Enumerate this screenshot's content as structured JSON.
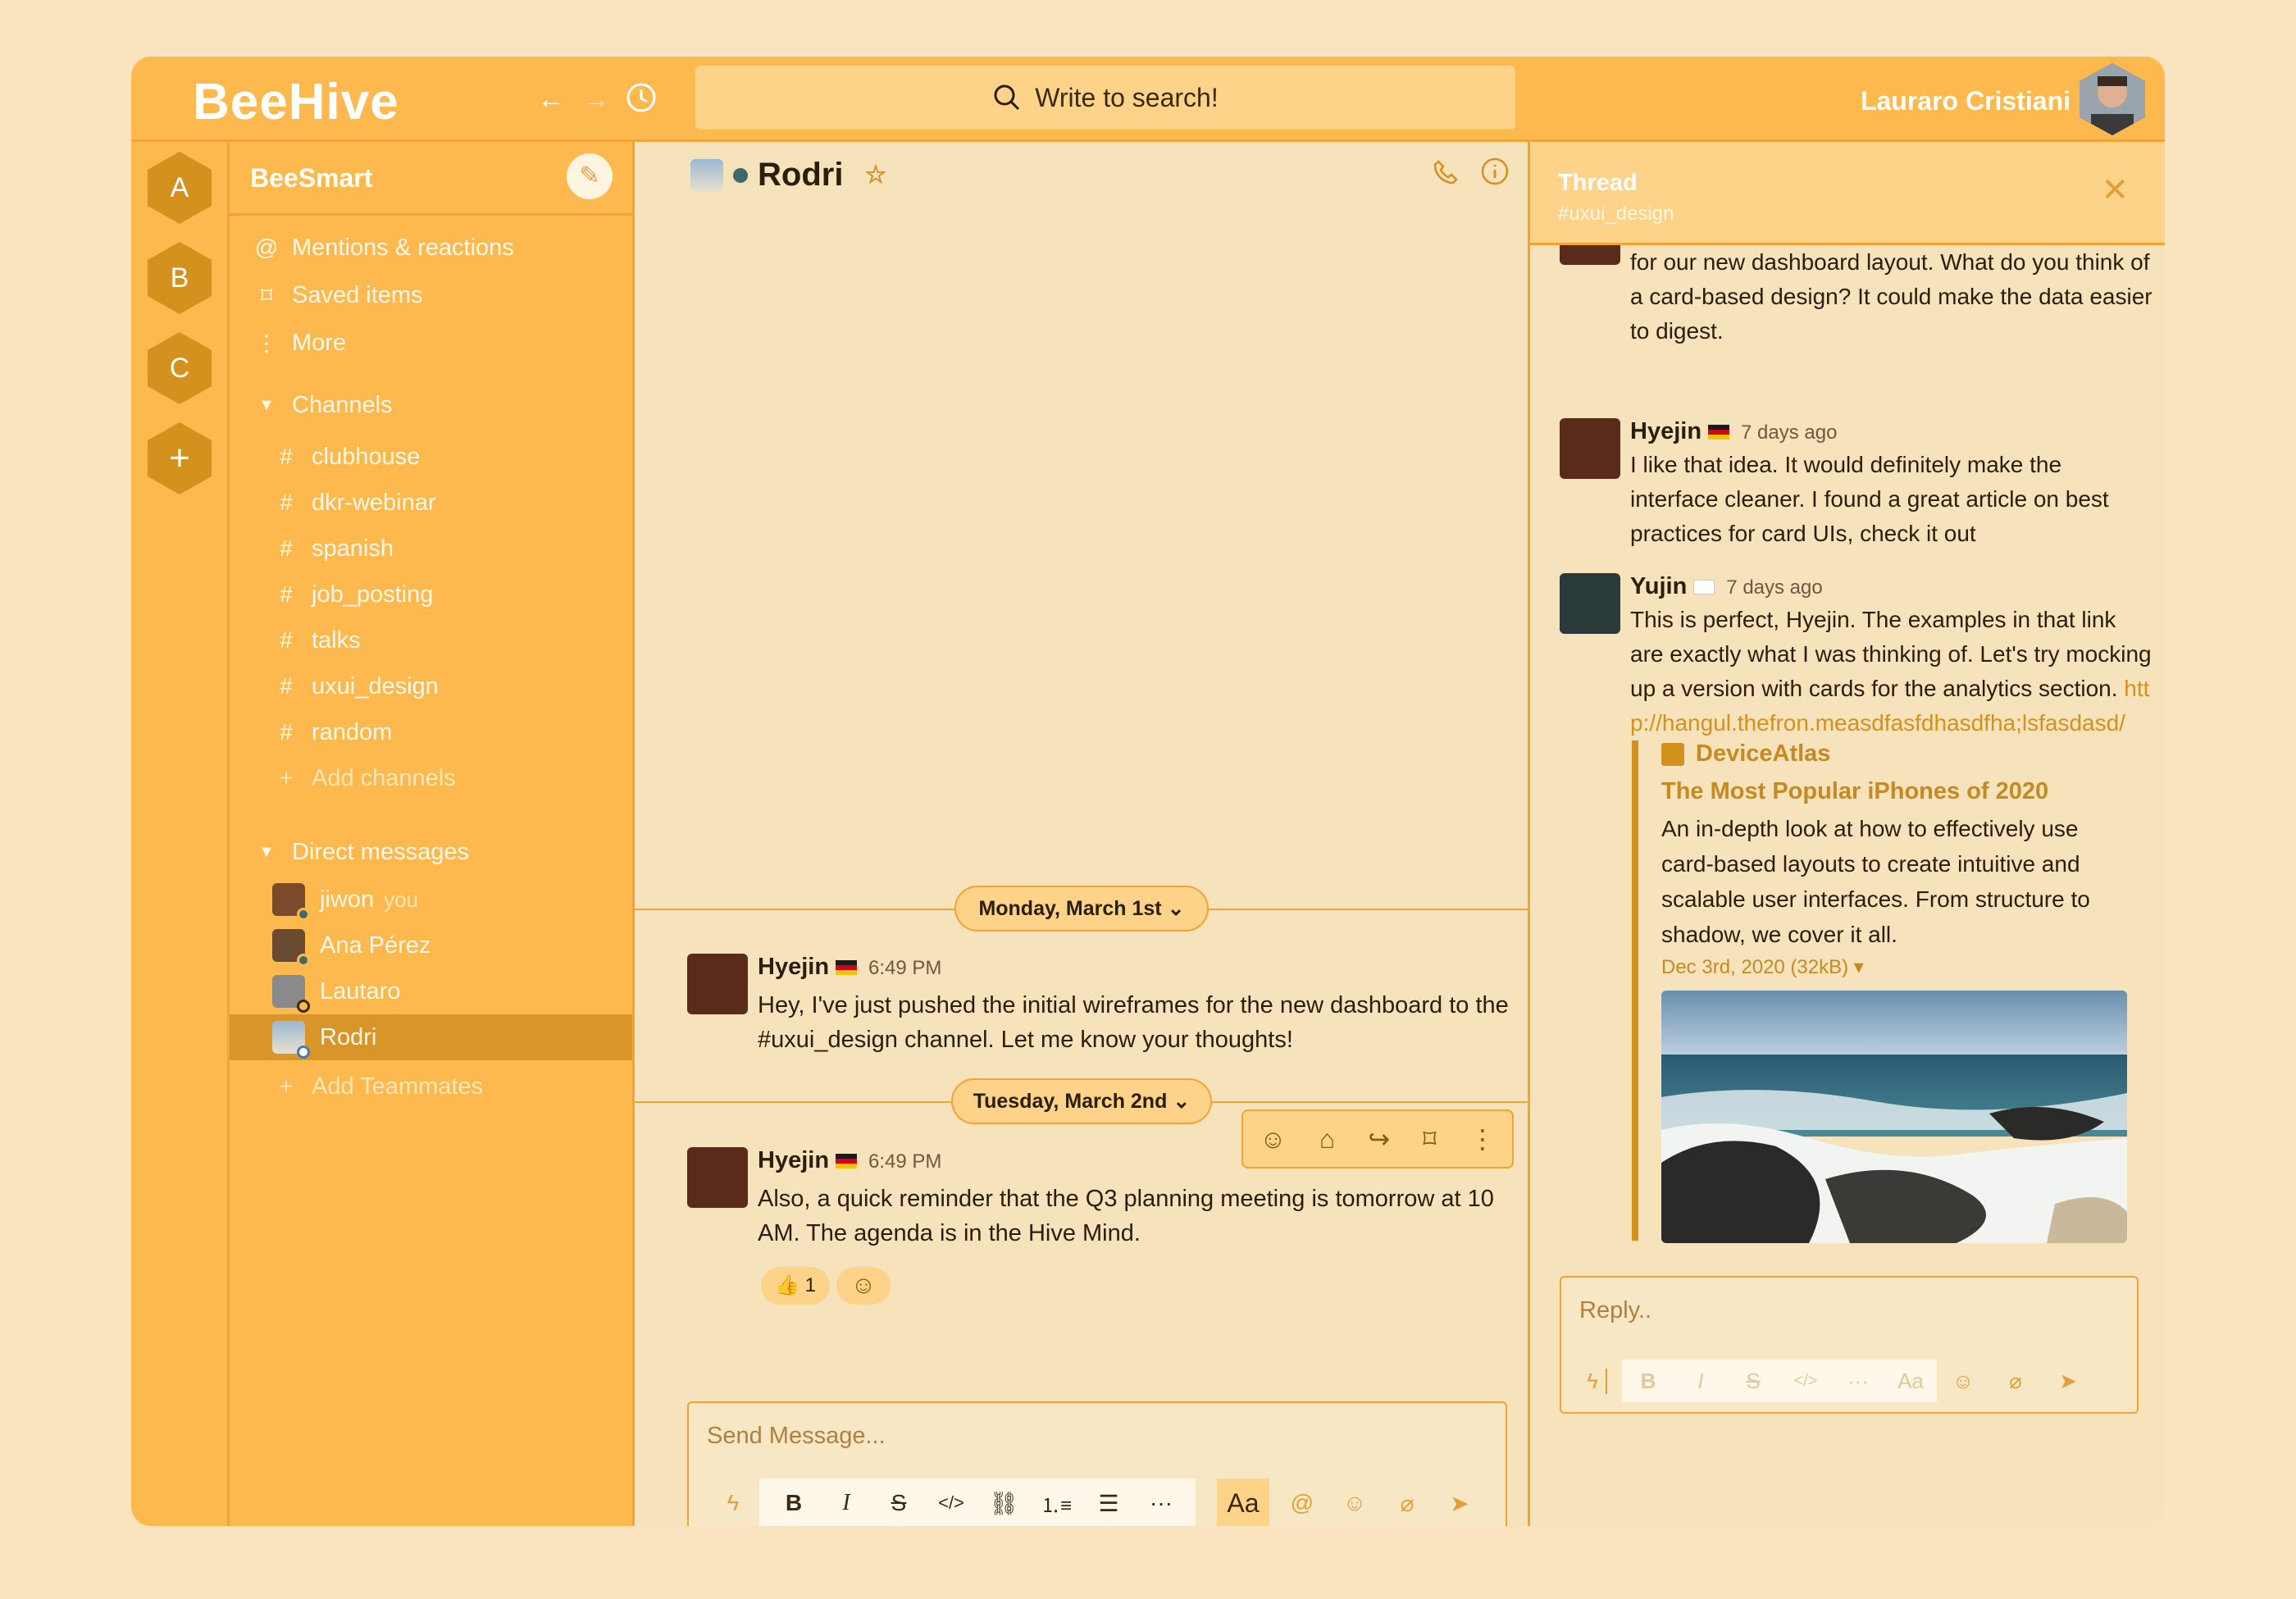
{
  "app": {
    "name": "BeeHive"
  },
  "topbar": {
    "search_placeholder": "Write to search!",
    "user_name": "Lauraro Cristiani"
  },
  "workspaces": [
    "A",
    "B",
    "C",
    "+"
  ],
  "sidebar": {
    "team": "BeeSmart",
    "nav": [
      "Mentions & reactions",
      "Saved items",
      "More"
    ],
    "channels_label": "Channels",
    "channels": [
      "clubhouse",
      "dkr-webinar",
      "spanish",
      "job_posting",
      "talks",
      "uxui_design",
      "random"
    ],
    "add_channels": "Add channels",
    "dm_label": "Direct messages",
    "dms": [
      {
        "name": "jiwon",
        "suffix": "you"
      },
      {
        "name": "Ana Pérez"
      },
      {
        "name": "Lautaro"
      },
      {
        "name": "Rodri"
      }
    ],
    "add_teammates": "Add Teammates"
  },
  "channel": {
    "title": "Rodri",
    "days": [
      "Monday, March 1st",
      "Tuesday, March 2nd"
    ],
    "messages": [
      {
        "author": "Hyejin",
        "time": "6:49 PM",
        "text": "Hey, I've just pushed the initial wireframes for the new dashboard to the #uxui_design channel. Let me know your thoughts!"
      },
      {
        "author": "Hyejin",
        "time": "6:49 PM",
        "text": "Also, a quick reminder that the Q3 planning meeting is tomorrow at 10 AM. The agenda is in the Hive Mind."
      }
    ],
    "reaction_count": "1",
    "composer_placeholder": "Send Message...",
    "format_label": "Aa"
  },
  "thread": {
    "title": "Thread",
    "channel": "#uxui_design",
    "first_text": "for our new dashboard layout. What do you think of a card-based design? It could make the data easier to digest.",
    "messages": [
      {
        "author": "Hyejin",
        "time": "7 days ago",
        "text": "I like that idea. It would definitely make the interface cleaner. I found a great article on best practices for card UIs, check it out"
      },
      {
        "author": "Yujin",
        "time": "7 days ago",
        "text": "This is perfect, Hyejin. The examples in that link are exactly what I was thinking of. Let's try mocking up a version with cards for the analytics section. ",
        "link": "http://hangul.thefron.measdfasfdhasdfha;lsfasdasd/"
      }
    ],
    "card": {
      "source": "DeviceAtlas",
      "title": "The Most Popular iPhones of 2020",
      "description": "An in-depth look at how to effectively use card-based layouts to create intuitive and scalable user interfaces. From structure to shadow, we cover it all.",
      "meta": "Dec 3rd, 2020 (32kB) ▾"
    },
    "reply_placeholder": "Reply..",
    "format_label": "Aa"
  }
}
